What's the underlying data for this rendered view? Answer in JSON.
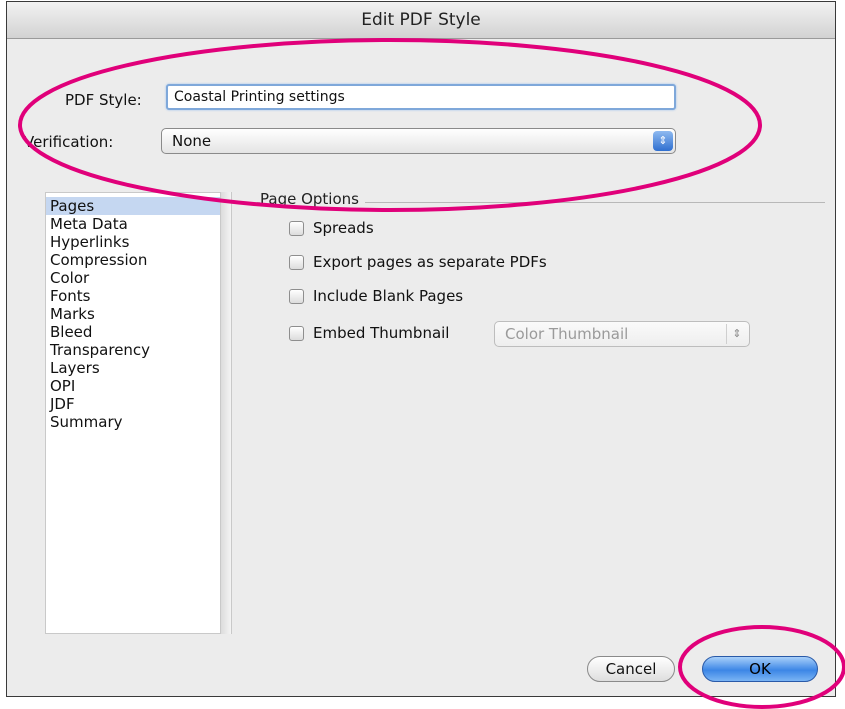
{
  "window": {
    "title": "Edit PDF Style"
  },
  "pdf_style": {
    "label": "PDF Style:",
    "value": "Coastal Printing settings"
  },
  "verification": {
    "label": "Verification:",
    "selected": "None"
  },
  "sidebar": {
    "items": [
      {
        "label": "Pages",
        "selected": true
      },
      {
        "label": "Meta Data"
      },
      {
        "label": "Hyperlinks"
      },
      {
        "label": "Compression"
      },
      {
        "label": "Color"
      },
      {
        "label": "Fonts"
      },
      {
        "label": "Marks"
      },
      {
        "label": "Bleed"
      },
      {
        "label": "Transparency"
      },
      {
        "label": "Layers"
      },
      {
        "label": "OPI"
      },
      {
        "label": "JDF"
      },
      {
        "label": "Summary"
      }
    ]
  },
  "page_options": {
    "title": "Page Options",
    "spreads": {
      "label": "Spreads",
      "checked": false
    },
    "export_separate": {
      "label": "Export pages as separate PDFs",
      "checked": false
    },
    "include_blank": {
      "label": "Include Blank Pages",
      "checked": false
    },
    "embed_thumbnail": {
      "label": "Embed Thumbnail",
      "checked": false,
      "option": "Color Thumbnail",
      "option_enabled": false
    }
  },
  "buttons": {
    "cancel": "Cancel",
    "ok": "OK"
  },
  "colors": {
    "annotation": "#e0007a",
    "selection": "#c5d7f1",
    "default_button": "#3c86e6"
  },
  "icons": {
    "popup_arrows": "updown-arrows-icon"
  }
}
